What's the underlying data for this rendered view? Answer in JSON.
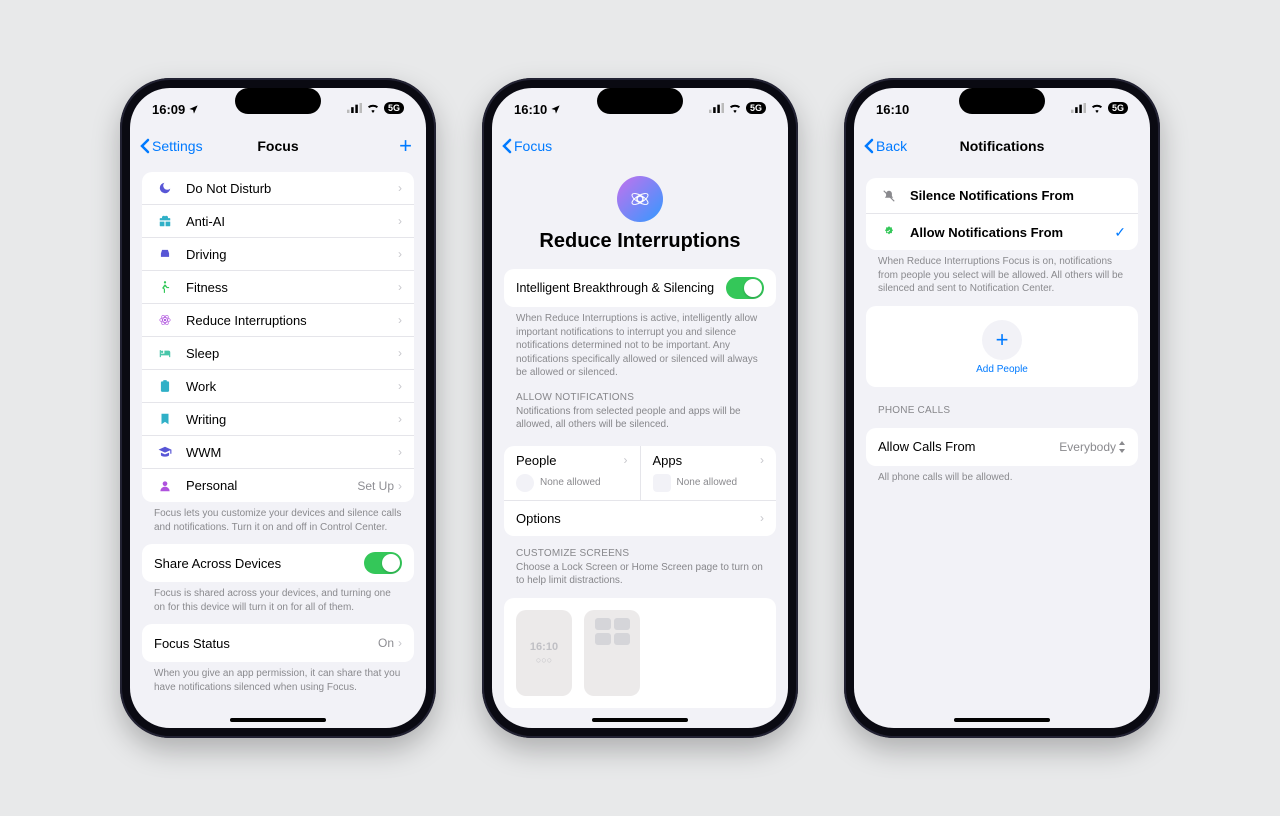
{
  "phone1": {
    "time": "16:09",
    "back": "Settings",
    "title": "Focus",
    "items": [
      {
        "label": "Do Not Disturb",
        "iconColor": "#5856d6"
      },
      {
        "label": "Anti-AI",
        "iconColor": "#30b0c7"
      },
      {
        "label": "Driving",
        "iconColor": "#5856d6"
      },
      {
        "label": "Fitness",
        "iconColor": "#34c759"
      },
      {
        "label": "Reduce Interruptions",
        "iconColor": "#af52de"
      },
      {
        "label": "Sleep",
        "iconColor": "#48c6a9"
      },
      {
        "label": "Work",
        "iconColor": "#30b0c7"
      },
      {
        "label": "Writing",
        "iconColor": "#30b0c7"
      },
      {
        "label": "WWM",
        "iconColor": "#5856d6"
      },
      {
        "label": "Personal",
        "iconColor": "#af52de",
        "detail": "Set Up"
      }
    ],
    "footer1": "Focus lets you customize your devices and silence calls and notifications. Turn it on and off in Control Center.",
    "share": "Share Across Devices",
    "footer2": "Focus is shared across your devices, and turning one on for this device will turn it on for all of them.",
    "status": "Focus Status",
    "statusVal": "On",
    "footer3": "When you give an app permission, it can share that you have notifications silenced when using Focus."
  },
  "phone2": {
    "time": "16:10",
    "back": "Focus",
    "hero": "Reduce Interruptions",
    "toggleRow": "Intelligent Breakthrough & Silencing",
    "toggleDesc": "When Reduce Interruptions is active, intelligently allow important notifications to interrupt you and silence notifications determined not to be important. Any notifications specifically allowed or silenced will always be allowed or silenced.",
    "allowHeader": "ALLOW NOTIFICATIONS",
    "allowSub": "Notifications from selected people and apps will be allowed, all others will be silenced.",
    "people": "People",
    "apps": "Apps",
    "none": "None allowed",
    "options": "Options",
    "custHeader": "CUSTOMIZE SCREENS",
    "custSub": "Choose a Lock Screen or Home Screen page to turn on to help limit distractions.",
    "miniTime": "16:10"
  },
  "phone3": {
    "time": "16:10",
    "back": "Back",
    "title": "Notifications",
    "silence": "Silence Notifications From",
    "allow": "Allow Notifications From",
    "desc": "When Reduce Interruptions Focus is on, notifications from people you select will be allowed. All others will be silenced and sent to Notification Center.",
    "addPeople": "Add People",
    "phoneCalls": "PHONE CALLS",
    "callsFrom": "Allow Calls From",
    "callsVal": "Everybody",
    "callsFooter": "All phone calls will be allowed."
  },
  "status": {
    "cell": "5G"
  }
}
